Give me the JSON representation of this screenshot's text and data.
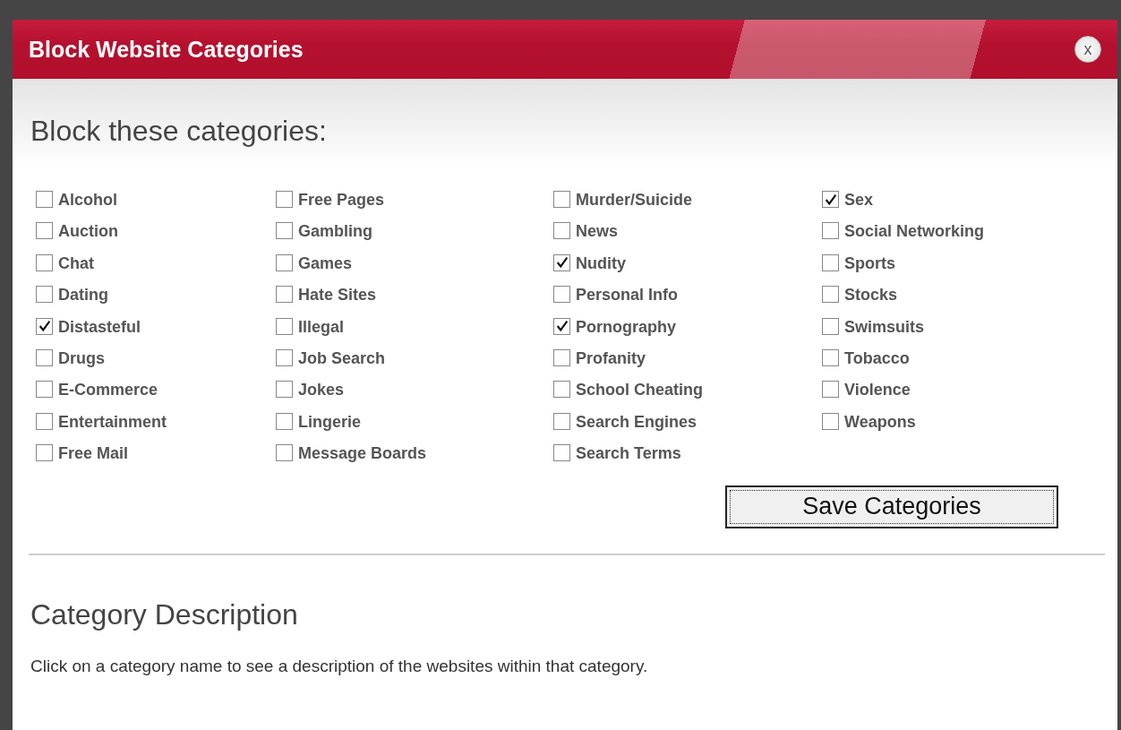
{
  "window": {
    "title": "Block Website Categories",
    "close": "x"
  },
  "heading": "Block these categories:",
  "columns": [
    [
      {
        "label": "Alcohol",
        "checked": false
      },
      {
        "label": "Auction",
        "checked": false
      },
      {
        "label": "Chat",
        "checked": false
      },
      {
        "label": "Dating",
        "checked": false
      },
      {
        "label": "Distasteful",
        "checked": true
      },
      {
        "label": "Drugs",
        "checked": false
      },
      {
        "label": "E-Commerce",
        "checked": false
      },
      {
        "label": "Entertainment",
        "checked": false
      },
      {
        "label": "Free Mail",
        "checked": false
      }
    ],
    [
      {
        "label": "Free Pages",
        "checked": false
      },
      {
        "label": "Gambling",
        "checked": false
      },
      {
        "label": "Games",
        "checked": false
      },
      {
        "label": "Hate Sites",
        "checked": false
      },
      {
        "label": "Illegal",
        "checked": false
      },
      {
        "label": "Job Search",
        "checked": false
      },
      {
        "label": "Jokes",
        "checked": false
      },
      {
        "label": "Lingerie",
        "checked": false
      },
      {
        "label": "Message Boards",
        "checked": false
      }
    ],
    [
      {
        "label": "Murder/Suicide",
        "checked": false
      },
      {
        "label": "News",
        "checked": false
      },
      {
        "label": "Nudity",
        "checked": true
      },
      {
        "label": "Personal Info",
        "checked": false
      },
      {
        "label": "Pornography",
        "checked": true
      },
      {
        "label": "Profanity",
        "checked": false
      },
      {
        "label": "School Cheating",
        "checked": false
      },
      {
        "label": "Search Engines",
        "checked": false
      },
      {
        "label": "Search Terms",
        "checked": false
      }
    ],
    [
      {
        "label": "Sex",
        "checked": true
      },
      {
        "label": "Social Networking",
        "checked": false
      },
      {
        "label": "Sports",
        "checked": false
      },
      {
        "label": "Stocks",
        "checked": false
      },
      {
        "label": "Swimsuits",
        "checked": false
      },
      {
        "label": "Tobacco",
        "checked": false
      },
      {
        "label": "Violence",
        "checked": false
      },
      {
        "label": "Weapons",
        "checked": false
      }
    ]
  ],
  "save_button": "Save Categories",
  "description": {
    "title": "Category Description",
    "text": "Click on a category name to see a description of the websites within that category."
  }
}
